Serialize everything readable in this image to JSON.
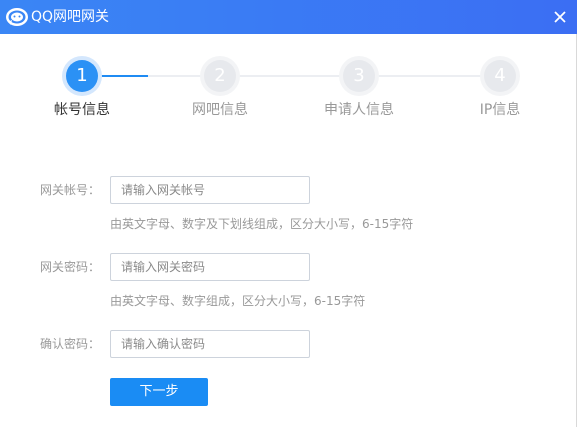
{
  "window": {
    "title": "QQ网吧网关",
    "accent": "#2b91f5",
    "titlebar_color": "#3b78f4"
  },
  "steps": [
    {
      "number": "1",
      "label": "帐号信息",
      "active": true
    },
    {
      "number": "2",
      "label": "网吧信息",
      "active": false
    },
    {
      "number": "3",
      "label": "申请人信息",
      "active": false
    },
    {
      "number": "4",
      "label": "IP信息",
      "active": false
    }
  ],
  "form": {
    "account": {
      "label": "网关帐号：",
      "placeholder": "请输入网关帐号",
      "value": "",
      "hint": "由英文字母、数字及下划线组成，区分大小写，6-15字符"
    },
    "password": {
      "label": "网关密码：",
      "placeholder": "请输入网关密码",
      "value": "",
      "hint": "由英文字母、数字组成，区分大小写，6-15字符"
    },
    "confirm": {
      "label": "确认密码：",
      "placeholder": "请输入确认密码",
      "value": ""
    }
  },
  "buttons": {
    "next": "下一步"
  },
  "icons": {
    "logo": "qq-cafe-logo-icon",
    "close": "close-icon"
  }
}
